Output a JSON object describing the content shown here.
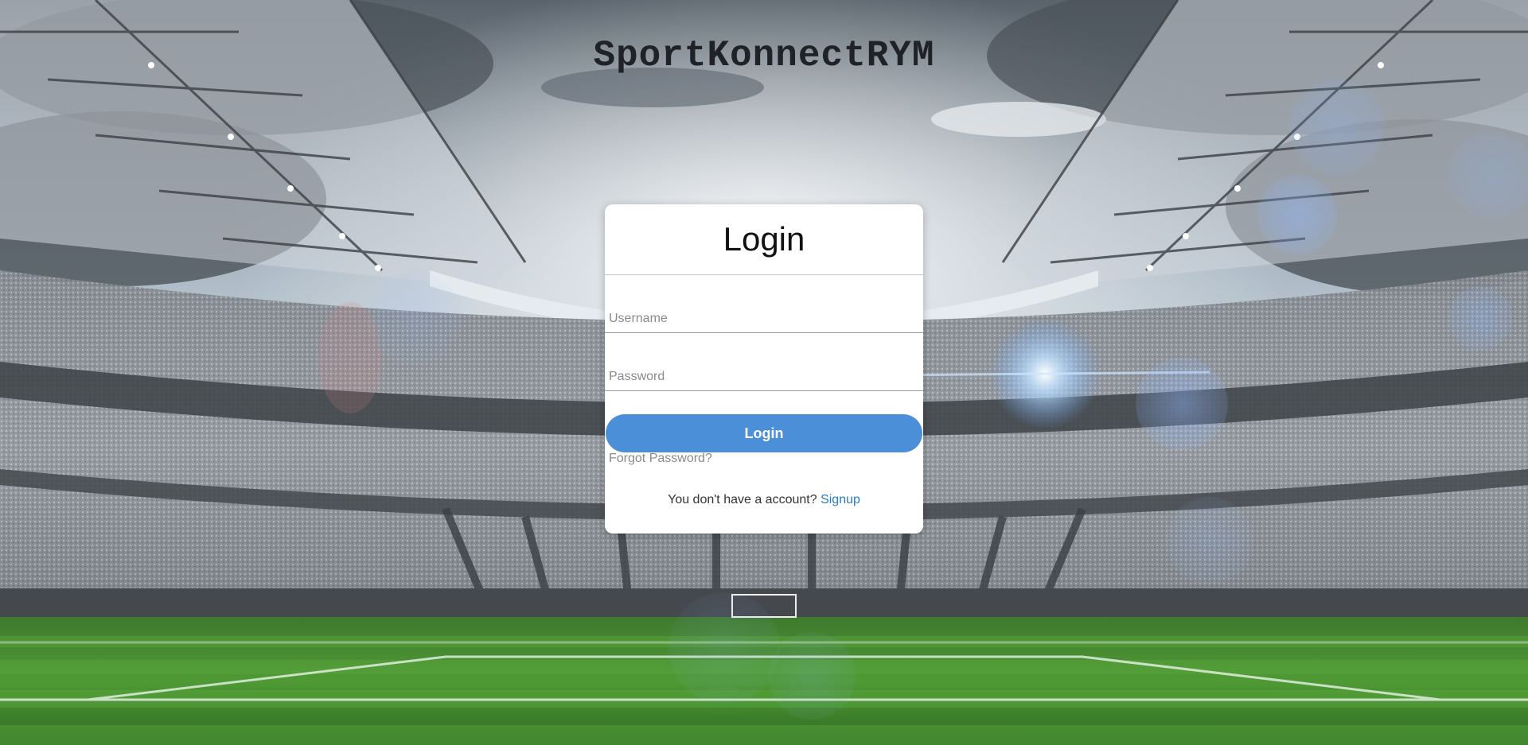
{
  "app": {
    "title": "SportKonnectRYM"
  },
  "login_card": {
    "heading": "Login",
    "username": {
      "value": "",
      "placeholder": "Username"
    },
    "password": {
      "value": "",
      "placeholder": "Password"
    },
    "login_button_label": "Login",
    "forgot_password_link": "Forgot Password?",
    "signup_prompt": "You don't have a account?",
    "signup_link": "Signup"
  },
  "colors": {
    "button": "#4a8fd8",
    "link": "#2b7bc4",
    "card_background": "#ffffff"
  },
  "background": {
    "description_icon": "stadium-background"
  }
}
